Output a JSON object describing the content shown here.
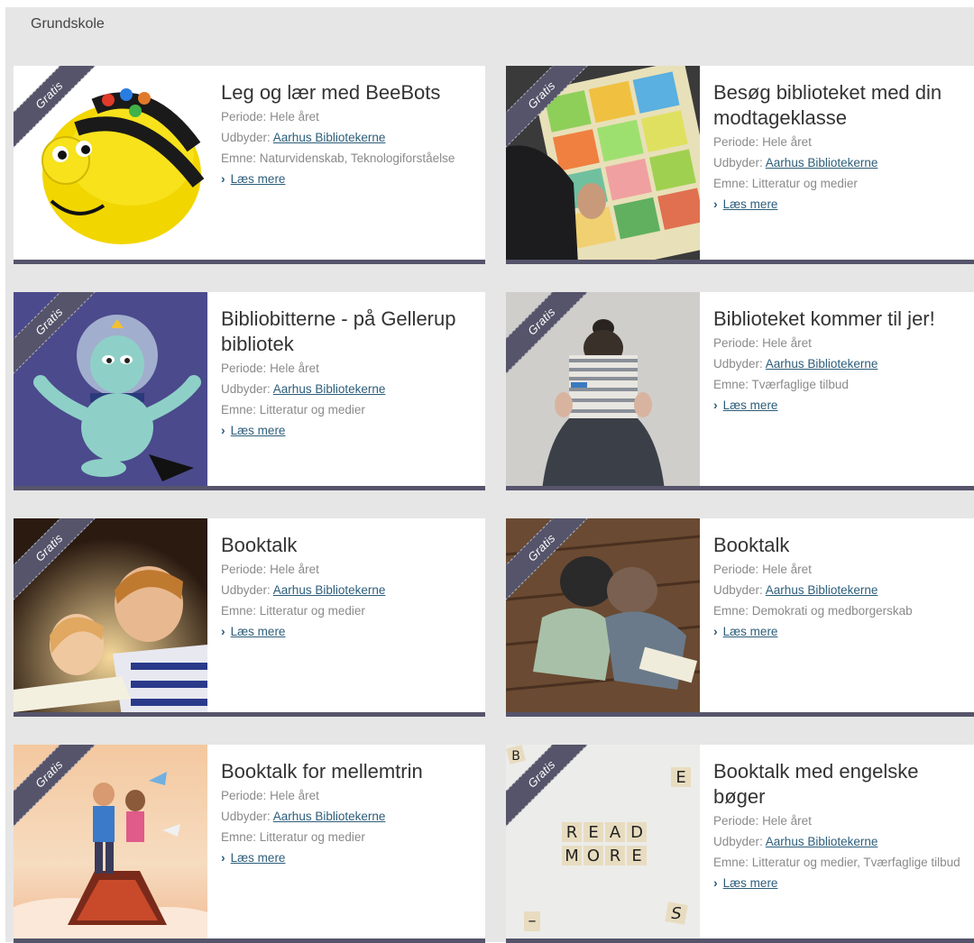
{
  "section": {
    "label": "Grundskole"
  },
  "ribbon_label": "Gratis",
  "read_more_label": "Læs mere",
  "cards": [
    {
      "title": "Leg og lær med BeeBots",
      "periode_label": "Periode:",
      "periode": "Hele året",
      "udbyder_label": "Udbyder:",
      "udbyder": "Aarhus Bibliotekerne",
      "emne_label": "Emne:",
      "emne": "Naturvidenskab, Teknologiforståelse"
    },
    {
      "title": "Besøg biblioteket med din modtageklasse",
      "periode_label": "Periode:",
      "periode": "Hele året",
      "udbyder_label": "Udbyder:",
      "udbyder": "Aarhus Bibliotekerne",
      "emne_label": "Emne:",
      "emne": "Litteratur og medier"
    },
    {
      "title": "Bibliobitterne - på Gellerup bibliotek",
      "periode_label": "Periode:",
      "periode": "Hele året",
      "udbyder_label": "Udbyder:",
      "udbyder": "Aarhus Bibliotekerne",
      "emne_label": "Emne:",
      "emne": "Litteratur og medier"
    },
    {
      "title": "Biblioteket kommer til jer!",
      "periode_label": "Periode:",
      "periode": "Hele året",
      "udbyder_label": "Udbyder:",
      "udbyder": "Aarhus Bibliotekerne",
      "emne_label": "Emne:",
      "emne": "Tværfaglige tilbud"
    },
    {
      "title": "Booktalk",
      "periode_label": "Periode:",
      "periode": "Hele året",
      "udbyder_label": "Udbyder:",
      "udbyder": "Aarhus Bibliotekerne",
      "emne_label": "Emne:",
      "emne": "Litteratur og medier"
    },
    {
      "title": "Booktalk",
      "periode_label": "Periode:",
      "periode": "Hele året",
      "udbyder_label": "Udbyder:",
      "udbyder": "Aarhus Bibliotekerne",
      "emne_label": "Emne:",
      "emne": "Demokrati og medborgerskab"
    },
    {
      "title": "Booktalk for mellemtrin",
      "periode_label": "Periode:",
      "periode": "Hele året",
      "udbyder_label": "Udbyder:",
      "udbyder": "Aarhus Bibliotekerne",
      "emne_label": "Emne:",
      "emne": "Litteratur og medier"
    },
    {
      "title": "Booktalk med engelske bøger",
      "periode_label": "Periode:",
      "periode": "Hele året",
      "udbyder_label": "Udbyder:",
      "udbyder": "Aarhus Bibliotekerne",
      "emne_label": "Emne:",
      "emne": "Litteratur og medier, Tværfaglige tilbud"
    }
  ],
  "image_texts": {
    "read": "READ",
    "more": "MORE",
    "e": "E",
    "b": "B",
    "s": "S"
  }
}
